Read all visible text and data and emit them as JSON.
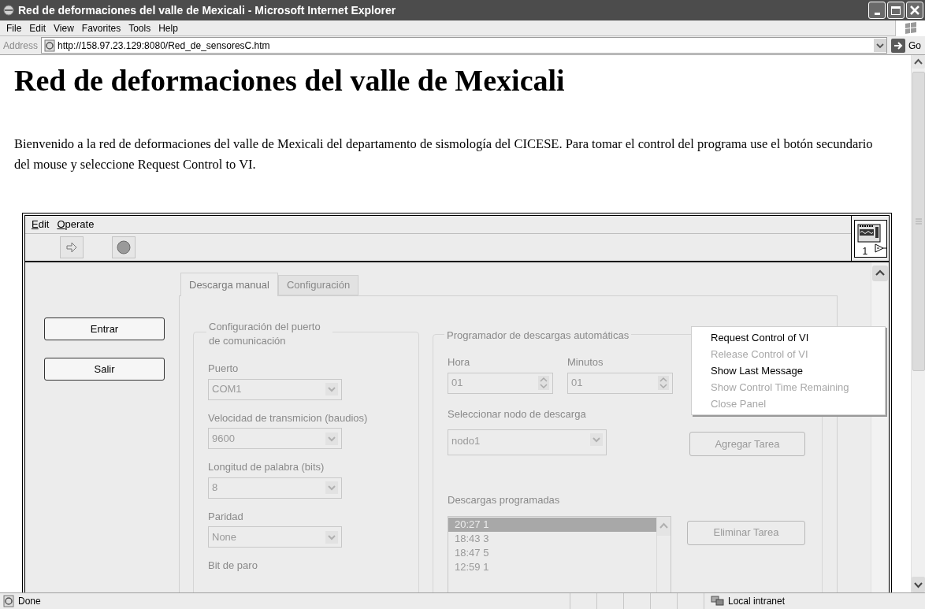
{
  "window": {
    "title": "Red de deformaciones del valle de Mexicali - Microsoft Internet Explorer"
  },
  "menu_bar": [
    "File",
    "Edit",
    "View",
    "Favorites",
    "Tools",
    "Help"
  ],
  "address_bar": {
    "label": "Address",
    "url": "http://158.97.23.129:8080/Red_de_sensoresC.htm",
    "go_label": "Go"
  },
  "page": {
    "heading": "Red de deformaciones del valle de Mexicali",
    "paragraph": "Bienvenido a la red de deformaciones del valle de Mexicali del departamento de sismología del CICESE. Para tomar el control del programa use el botón secundario del mouse y seleccione Request Control to VI."
  },
  "vi_panel": {
    "menu": [
      "Edit",
      "Operate"
    ],
    "vi_number": "1",
    "buttons": [
      "Entrar",
      "Salir"
    ],
    "tabs": [
      {
        "label": "Descarga manual",
        "selected": true
      },
      {
        "label": "Configuración",
        "selected": false
      }
    ],
    "port_group": {
      "title": "Configuración del puerto de comunicación",
      "fields": [
        {
          "label": "Puerto",
          "value": "COM1"
        },
        {
          "label": "Velocidad de transmicion (baudios)",
          "value": "9600"
        },
        {
          "label": "Longitud de palabra  (bits)",
          "value": "8"
        },
        {
          "label": "Paridad",
          "value": "None"
        },
        {
          "label": "Bit de paro"
        }
      ]
    },
    "scheduler": {
      "title": "Programador de descargas automáticas",
      "spinners": [
        {
          "label": "Hora",
          "value": "01"
        },
        {
          "label": "Minutos",
          "value": "01"
        }
      ],
      "node": {
        "label": "Seleccionar nodo de descarga",
        "value": "nodo1"
      },
      "add_button": "Agregar Tarea",
      "list_label": "Descargas programadas",
      "list": [
        {
          "text": "20:27 1",
          "selected": true
        },
        {
          "text": "18:43 3",
          "selected": false
        },
        {
          "text": "18:47 5",
          "selected": false
        },
        {
          "text": "12:59 1",
          "selected": false
        }
      ],
      "remove_button": "Eliminar Tarea"
    },
    "context_menu": [
      {
        "label": "Request Control of VI",
        "disabled": false
      },
      {
        "label": "Release Control of VI",
        "disabled": true
      },
      {
        "label": "Show Last Message",
        "disabled": false
      },
      {
        "label": "Show Control Time Remaining",
        "disabled": true
      },
      {
        "label": "Close Panel",
        "disabled": true
      }
    ]
  },
  "status_bar": {
    "text": "Done",
    "zone": "Local intranet"
  }
}
